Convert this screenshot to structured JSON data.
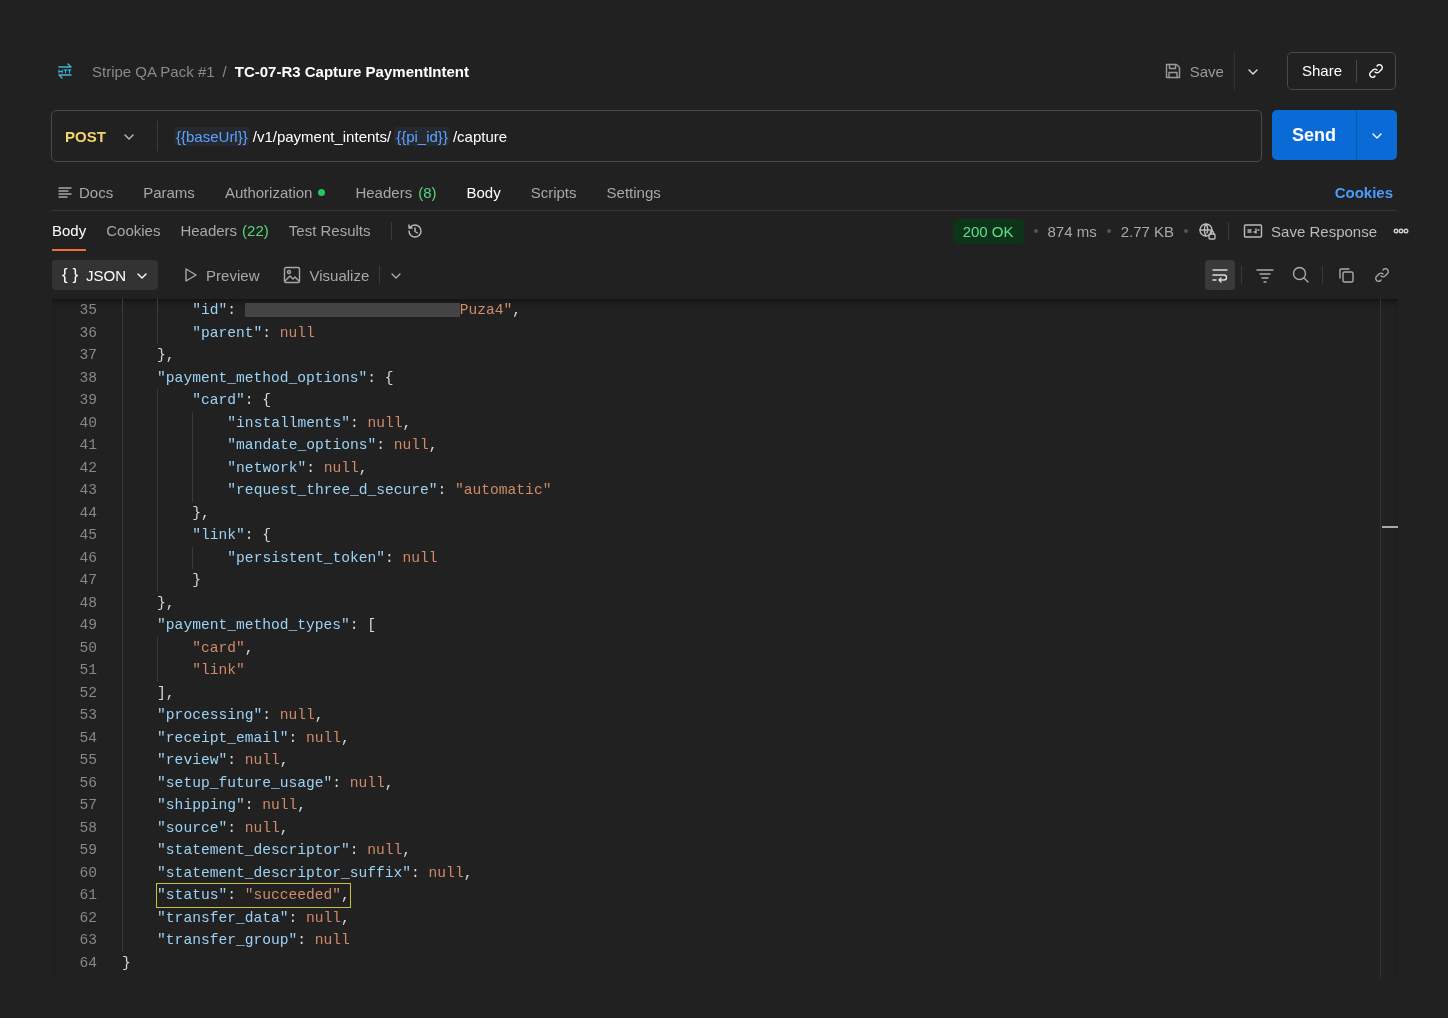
{
  "header": {
    "collection": "Stripe QA Pack #1",
    "separator": "/",
    "title": "TC-07-R3 Capture PaymentIntent",
    "save_label": "Save",
    "share_label": "Share"
  },
  "request": {
    "method": "POST",
    "url": [
      {
        "kind": "variable",
        "text": "{{baseUrl}}"
      },
      {
        "kind": "path",
        "text": "/v1/payment_intents/"
      },
      {
        "kind": "variable",
        "text": "{{pi_id}}"
      },
      {
        "kind": "path",
        "text": "/capture"
      }
    ],
    "send_label": "Send"
  },
  "request_tabs": [
    {
      "label": "Docs",
      "kind": "docs",
      "selected": false,
      "indicator": false
    },
    {
      "label": "Params",
      "kind": "plain",
      "selected": false,
      "indicator": false
    },
    {
      "label": "Authorization",
      "kind": "plain",
      "selected": false,
      "indicator": true
    },
    {
      "label": "Headers",
      "count": "(8)",
      "kind": "plain",
      "selected": false,
      "indicator": false
    },
    {
      "label": "Body",
      "kind": "plain",
      "selected": true,
      "indicator": false
    },
    {
      "label": "Scripts",
      "kind": "plain",
      "selected": false,
      "indicator": false
    },
    {
      "label": "Settings",
      "kind": "plain",
      "selected": false,
      "indicator": false
    }
  ],
  "cookies_link": "Cookies",
  "response_tabs": [
    {
      "label": "Body",
      "selected": true
    },
    {
      "label": "Cookies",
      "selected": false
    },
    {
      "label": "Headers",
      "count": "(22)",
      "selected": false
    },
    {
      "label": "Test Results",
      "selected": false
    }
  ],
  "response_meta": {
    "status": "200 OK",
    "time": "874 ms",
    "size": "2.77 KB",
    "save_response": "Save Response"
  },
  "view": {
    "format_icon": "{ }",
    "format": "JSON",
    "preview": "Preview",
    "visualize": "Visualize",
    "wrap_on": true
  },
  "code_lines": [
    {
      "number": "35",
      "highlighted": false,
      "tokens": [
        {
          "kind": "key",
          "text": "        \"id\""
        },
        {
          "kind": "punct",
          "text": ": "
        },
        {
          "kind": "redacted"
        },
        {
          "kind": "string",
          "text": "Puza4\""
        },
        {
          "kind": "punct",
          "text": ","
        }
      ]
    },
    {
      "number": "36",
      "highlighted": false,
      "tokens": [
        {
          "kind": "key",
          "text": "        \"parent\""
        },
        {
          "kind": "punct",
          "text": ": "
        },
        {
          "kind": "null",
          "text": "null"
        }
      ]
    },
    {
      "number": "37",
      "highlighted": false,
      "tokens": [
        {
          "kind": "punct",
          "text": "    },"
        }
      ]
    },
    {
      "number": "38",
      "highlighted": false,
      "tokens": [
        {
          "kind": "key",
          "text": "    \"payment_method_options\""
        },
        {
          "kind": "punct",
          "text": ": {"
        }
      ]
    },
    {
      "number": "39",
      "highlighted": false,
      "tokens": [
        {
          "kind": "key",
          "text": "        \"card\""
        },
        {
          "kind": "punct",
          "text": ": {"
        }
      ]
    },
    {
      "number": "40",
      "highlighted": false,
      "tokens": [
        {
          "kind": "key",
          "text": "            \"installments\""
        },
        {
          "kind": "punct",
          "text": ": "
        },
        {
          "kind": "null",
          "text": "null"
        },
        {
          "kind": "punct",
          "text": ","
        }
      ]
    },
    {
      "number": "41",
      "highlighted": false,
      "tokens": [
        {
          "kind": "key",
          "text": "            \"mandate_options\""
        },
        {
          "kind": "punct",
          "text": ": "
        },
        {
          "kind": "null",
          "text": "null"
        },
        {
          "kind": "punct",
          "text": ","
        }
      ]
    },
    {
      "number": "42",
      "highlighted": false,
      "tokens": [
        {
          "kind": "key",
          "text": "            \"network\""
        },
        {
          "kind": "punct",
          "text": ": "
        },
        {
          "kind": "null",
          "text": "null"
        },
        {
          "kind": "punct",
          "text": ","
        }
      ]
    },
    {
      "number": "43",
      "highlighted": false,
      "tokens": [
        {
          "kind": "key",
          "text": "            \"request_three_d_secure\""
        },
        {
          "kind": "punct",
          "text": ": "
        },
        {
          "kind": "string",
          "text": "\"automatic\""
        }
      ]
    },
    {
      "number": "44",
      "highlighted": false,
      "tokens": [
        {
          "kind": "punct",
          "text": "        },"
        }
      ]
    },
    {
      "number": "45",
      "highlighted": false,
      "tokens": [
        {
          "kind": "key",
          "text": "        \"link\""
        },
        {
          "kind": "punct",
          "text": ": {"
        }
      ]
    },
    {
      "number": "46",
      "highlighted": false,
      "tokens": [
        {
          "kind": "key",
          "text": "            \"persistent_token\""
        },
        {
          "kind": "punct",
          "text": ": "
        },
        {
          "kind": "null",
          "text": "null"
        }
      ]
    },
    {
      "number": "47",
      "highlighted": false,
      "tokens": [
        {
          "kind": "punct",
          "text": "        }"
        }
      ]
    },
    {
      "number": "48",
      "highlighted": false,
      "tokens": [
        {
          "kind": "punct",
          "text": "    },"
        }
      ]
    },
    {
      "number": "49",
      "highlighted": false,
      "tokens": [
        {
          "kind": "key",
          "text": "    \"payment_method_types\""
        },
        {
          "kind": "punct",
          "text": ": ["
        }
      ]
    },
    {
      "number": "50",
      "highlighted": false,
      "tokens": [
        {
          "kind": "string",
          "text": "        \"card\""
        },
        {
          "kind": "punct",
          "text": ","
        }
      ]
    },
    {
      "number": "51",
      "highlighted": false,
      "tokens": [
        {
          "kind": "string",
          "text": "        \"link\""
        }
      ]
    },
    {
      "number": "52",
      "highlighted": false,
      "tokens": [
        {
          "kind": "punct",
          "text": "    ],"
        }
      ]
    },
    {
      "number": "53",
      "highlighted": false,
      "tokens": [
        {
          "kind": "key",
          "text": "    \"processing\""
        },
        {
          "kind": "punct",
          "text": ": "
        },
        {
          "kind": "null",
          "text": "null"
        },
        {
          "kind": "punct",
          "text": ","
        }
      ]
    },
    {
      "number": "54",
      "highlighted": false,
      "tokens": [
        {
          "kind": "key",
          "text": "    \"receipt_email\""
        },
        {
          "kind": "punct",
          "text": ": "
        },
        {
          "kind": "null",
          "text": "null"
        },
        {
          "kind": "punct",
          "text": ","
        }
      ]
    },
    {
      "number": "55",
      "highlighted": false,
      "tokens": [
        {
          "kind": "key",
          "text": "    \"review\""
        },
        {
          "kind": "punct",
          "text": ": "
        },
        {
          "kind": "null",
          "text": "null"
        },
        {
          "kind": "punct",
          "text": ","
        }
      ]
    },
    {
      "number": "56",
      "highlighted": false,
      "tokens": [
        {
          "kind": "key",
          "text": "    \"setup_future_usage\""
        },
        {
          "kind": "punct",
          "text": ": "
        },
        {
          "kind": "null",
          "text": "null"
        },
        {
          "kind": "punct",
          "text": ","
        }
      ]
    },
    {
      "number": "57",
      "highlighted": false,
      "tokens": [
        {
          "kind": "key",
          "text": "    \"shipping\""
        },
        {
          "kind": "punct",
          "text": ": "
        },
        {
          "kind": "null",
          "text": "null"
        },
        {
          "kind": "punct",
          "text": ","
        }
      ]
    },
    {
      "number": "58",
      "highlighted": false,
      "tokens": [
        {
          "kind": "key",
          "text": "    \"source\""
        },
        {
          "kind": "punct",
          "text": ": "
        },
        {
          "kind": "null",
          "text": "null"
        },
        {
          "kind": "punct",
          "text": ","
        }
      ]
    },
    {
      "number": "59",
      "highlighted": false,
      "tokens": [
        {
          "kind": "key",
          "text": "    \"statement_descriptor\""
        },
        {
          "kind": "punct",
          "text": ": "
        },
        {
          "kind": "null",
          "text": "null"
        },
        {
          "kind": "punct",
          "text": ","
        }
      ]
    },
    {
      "number": "60",
      "highlighted": false,
      "tokens": [
        {
          "kind": "key",
          "text": "    \"statement_descriptor_suffix\""
        },
        {
          "kind": "punct",
          "text": ": "
        },
        {
          "kind": "null",
          "text": "null"
        },
        {
          "kind": "punct",
          "text": ","
        }
      ]
    },
    {
      "number": "61",
      "highlighted": true,
      "tokens": [
        {
          "kind": "key",
          "text": "    \"status\""
        },
        {
          "kind": "punct",
          "text": ": "
        },
        {
          "kind": "string",
          "text": "\"succeeded\""
        },
        {
          "kind": "punct",
          "text": ","
        }
      ]
    },
    {
      "number": "62",
      "highlighted": false,
      "tokens": [
        {
          "kind": "key",
          "text": "    \"transfer_data\""
        },
        {
          "kind": "punct",
          "text": ": "
        },
        {
          "kind": "null",
          "text": "null"
        },
        {
          "kind": "punct",
          "text": ","
        }
      ]
    },
    {
      "number": "63",
      "highlighted": false,
      "tokens": [
        {
          "kind": "key",
          "text": "    \"transfer_group\""
        },
        {
          "kind": "punct",
          "text": ": "
        },
        {
          "kind": "null",
          "text": "null"
        }
      ]
    },
    {
      "number": "64",
      "highlighted": false,
      "tokens": [
        {
          "kind": "punct",
          "text": "}"
        }
      ]
    }
  ]
}
